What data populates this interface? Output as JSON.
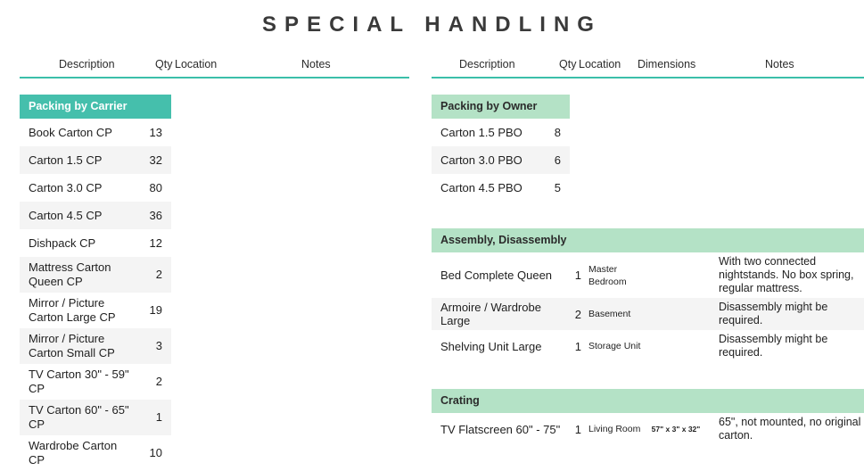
{
  "title": "SPECIAL HANDLING",
  "colors": {
    "accent_teal": "#45bfac",
    "accent_mint": "#b4e2c6",
    "row_alt_gray": "#f4f4f4",
    "title_gray": "#3a3a3a"
  },
  "left_table": {
    "headers": {
      "description": "Description",
      "qty": "Qty",
      "location": "Location",
      "notes": "Notes"
    },
    "groups": [
      {
        "name": "Packing by Carrier",
        "style": "teal",
        "rows": [
          {
            "description": "Book Carton CP",
            "qty": "13"
          },
          {
            "description": "Carton 1.5 CP",
            "qty": "32"
          },
          {
            "description": "Carton 3.0 CP",
            "qty": "80"
          },
          {
            "description": "Carton 4.5 CP",
            "qty": "36"
          },
          {
            "description": "Dishpack CP",
            "qty": "12"
          },
          {
            "description": "Mattress Carton Queen CP",
            "qty": "2"
          },
          {
            "description": "Mirror / Picture Carton Large CP",
            "qty": "19"
          },
          {
            "description": "Mirror / Picture Carton Small CP",
            "qty": "3"
          },
          {
            "description": "TV Carton 30\" - 59\" CP",
            "qty": "2"
          },
          {
            "description": "TV Carton 60\" - 65\" CP",
            "qty": "1"
          },
          {
            "description": "Wardrobe Carton CP",
            "qty": "10"
          }
        ]
      }
    ]
  },
  "right_table": {
    "headers": {
      "description": "Description",
      "qty": "Qty",
      "location": "Location",
      "dimensions": "Dimensions",
      "notes": "Notes"
    },
    "groups": [
      {
        "name": "Packing by Owner",
        "style": "mint-narrow",
        "rows": [
          {
            "description": "Carton 1.5 PBO",
            "qty": "8"
          },
          {
            "description": "Carton 3.0 PBO",
            "qty": "6"
          },
          {
            "description": "Carton 4.5 PBO",
            "qty": "5"
          }
        ]
      },
      {
        "name": "Assembly, Disassembly",
        "style": "mint-wide",
        "rows": [
          {
            "description": "Bed Complete Queen",
            "qty": "1",
            "location": "Master Bedroom",
            "dimensions": "",
            "notes": "With two connected nightstands. No box spring, regular mattress."
          },
          {
            "description": "Armoire / Wardrobe Large",
            "qty": "2",
            "location": "Basement",
            "dimensions": "",
            "notes": "Disassembly might be required."
          },
          {
            "description": "Shelving Unit Large",
            "qty": "1",
            "location": "Storage Unit",
            "dimensions": "",
            "notes": "Disassembly might be required."
          }
        ]
      },
      {
        "name": "Crating",
        "style": "mint-wide",
        "rows": [
          {
            "description": "TV Flatscreen 60\" - 75\"",
            "qty": "1",
            "location": "Living Room",
            "dimensions": "57\" x 3\" x 32\"",
            "notes": "65\", not mounted, no original carton."
          }
        ]
      }
    ]
  }
}
